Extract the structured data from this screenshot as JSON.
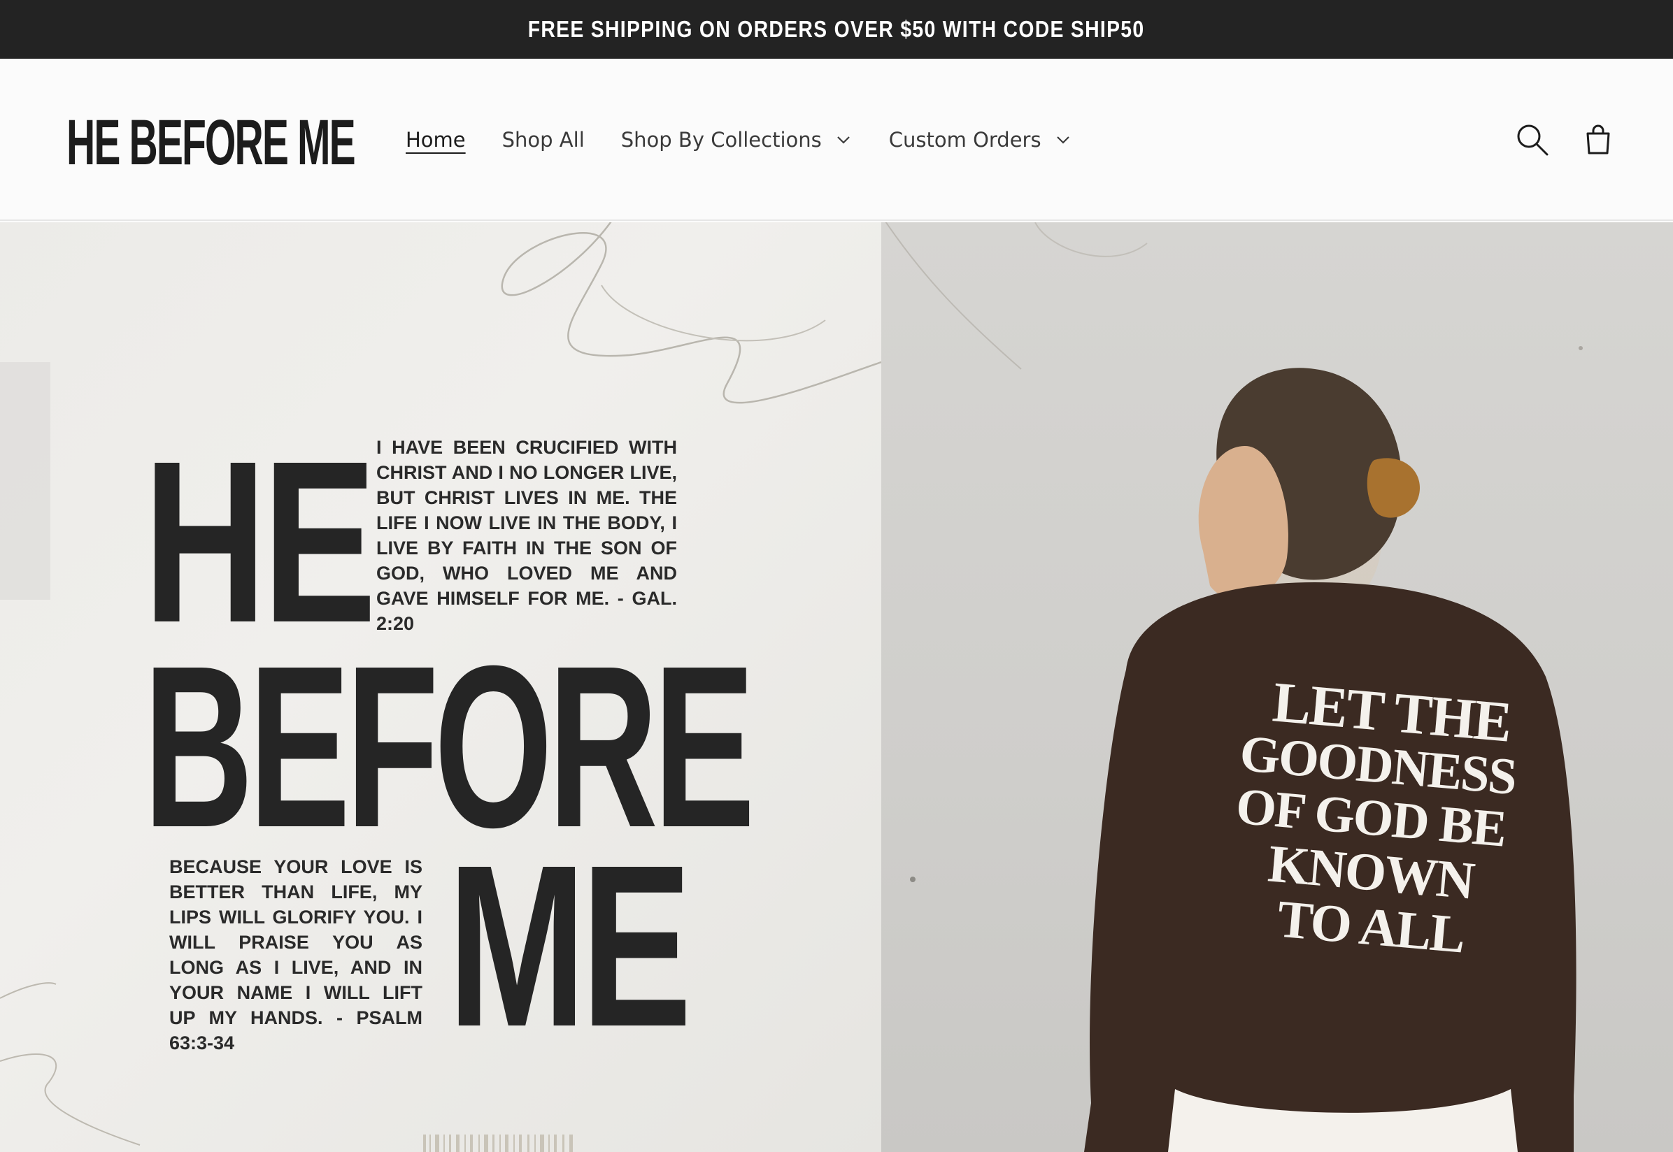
{
  "announcement": {
    "text": "FREE SHIPPING ON ORDERS OVER $50 WITH CODE SHIP50"
  },
  "header": {
    "logo": "HE BEFORE ME",
    "nav": [
      {
        "label": "Home",
        "active": true
      },
      {
        "label": "Shop All"
      },
      {
        "label": "Shop By Collections",
        "dropdown": true
      },
      {
        "label": "Custom Orders",
        "dropdown": true
      }
    ],
    "icons": [
      "search-icon",
      "cart-icon"
    ]
  },
  "hero": {
    "poster": {
      "word1": "HE",
      "word2": "BEFORE",
      "word3": "ME",
      "verse_top": "I have been crucified with Christ and I no longer live, but Christ lives in me. The life I now live in the body, I live by faith in the Son of God, who loved me and gave himself for me. - Gal. 2:20",
      "verse_bottom": "Because your love is better than life, my lips will glorify you. I will praise you as long as I live, and in your name I will lift up my hands. - Psalm 63:3-34"
    },
    "sweater": {
      "lines": [
        "LET THE",
        "GOODNESS",
        "OF GOD BE",
        "KNOWN",
        "TO ALL"
      ]
    }
  },
  "colors": {
    "announcement_bg": "#232323",
    "header_bg": "#fbfbfb",
    "text_dark": "#1c1c1c",
    "sweater": "#3b2a22"
  }
}
